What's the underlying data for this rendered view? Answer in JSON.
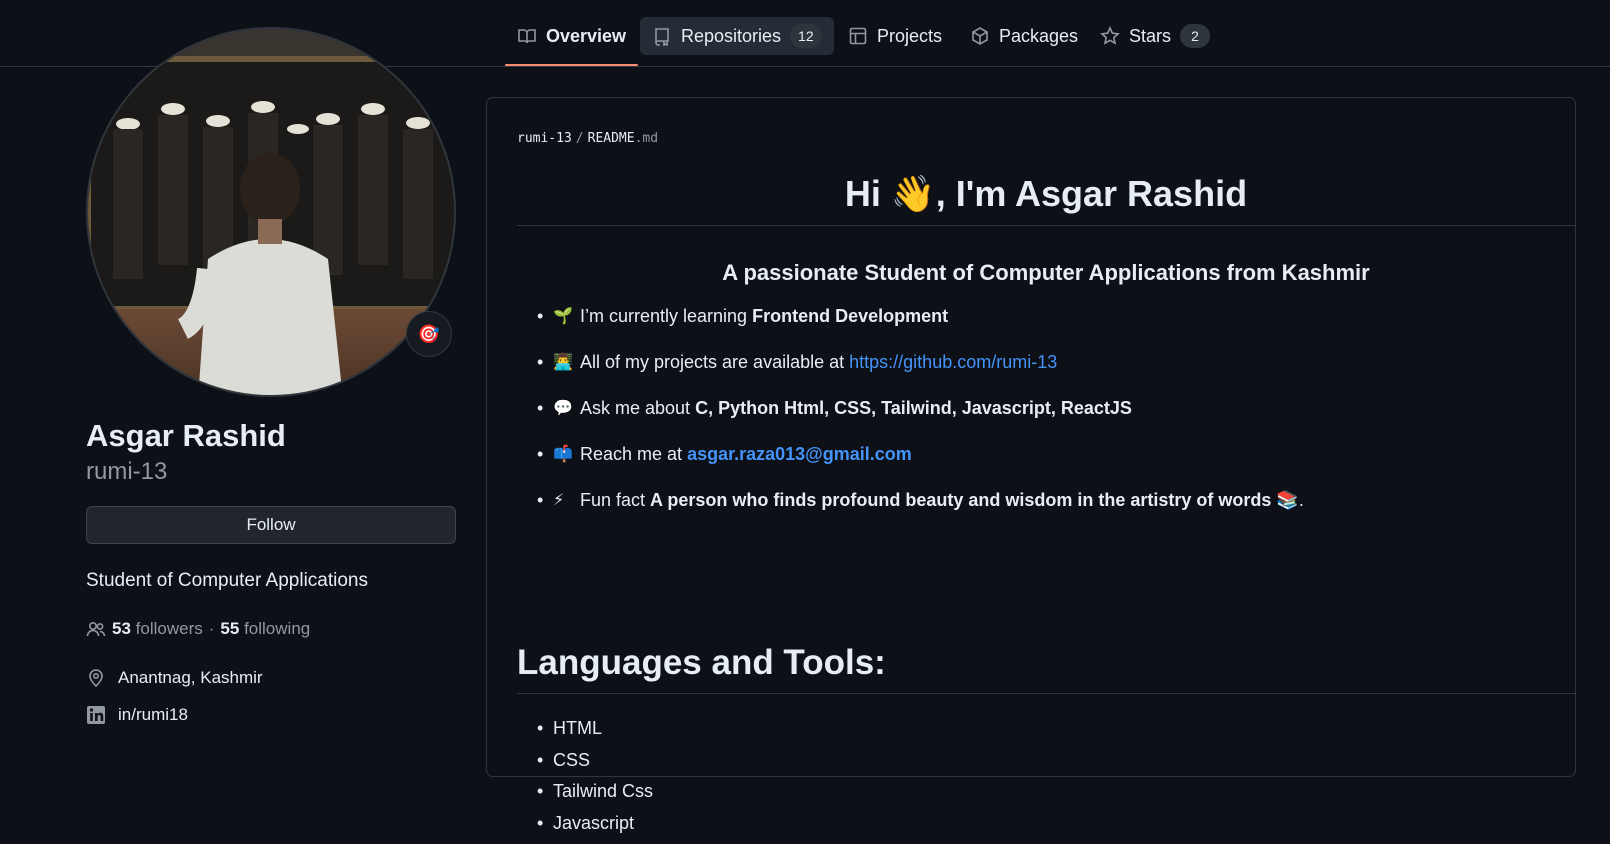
{
  "nav": {
    "tabs": [
      {
        "label": "Overview",
        "icon": "book-icon"
      },
      {
        "label": "Repositories",
        "count": "12",
        "icon": "repo-icon"
      },
      {
        "label": "Projects",
        "icon": "table-icon"
      },
      {
        "label": "Packages",
        "icon": "package-icon"
      },
      {
        "label": "Stars",
        "count": "2",
        "icon": "star-icon"
      }
    ]
  },
  "profile": {
    "name": "Asgar Rashid",
    "login": "rumi-13",
    "follow_label": "Follow",
    "bio": "Student of Computer Applications",
    "followers": "53",
    "followers_label": "followers",
    "separator": "·",
    "following": "55",
    "following_label": "following",
    "location": "Anantnag, Kashmir",
    "linkedin": "in/rumi18",
    "status_emoji": "🎯"
  },
  "readme": {
    "breadcrumb": {
      "user": "rumi-13",
      "sep": "/",
      "file": "README",
      "ext": ".md"
    },
    "heading": "Hi 👋, I'm Asgar Rashid",
    "subheading": "A passionate Student of Computer Applications from Kashmir",
    "bullets": [
      {
        "emoji": "🌱",
        "text": "I’m currently learning ",
        "strong": "Frontend Development"
      },
      {
        "emoji": "👨‍💻",
        "text": "All of my projects are available at ",
        "link": "https://github.com/rumi-13"
      },
      {
        "emoji": "💬",
        "text": "Ask me about ",
        "strong": "C, Python Html, CSS, Tailwind, Javascript, ReactJS"
      },
      {
        "emoji": "📫",
        "text": "Reach me at ",
        "link": "asgar.raza013@gmail.com"
      },
      {
        "emoji": "⚡",
        "text": "Fun fact ",
        "strong": "A person who finds profound beauty and wisdom in the artistry of words 📚",
        "suffix": "."
      }
    ],
    "tools_heading": "Languages and Tools:",
    "tools": [
      "HTML",
      "CSS",
      "Tailwind Css",
      "Javascript"
    ]
  }
}
